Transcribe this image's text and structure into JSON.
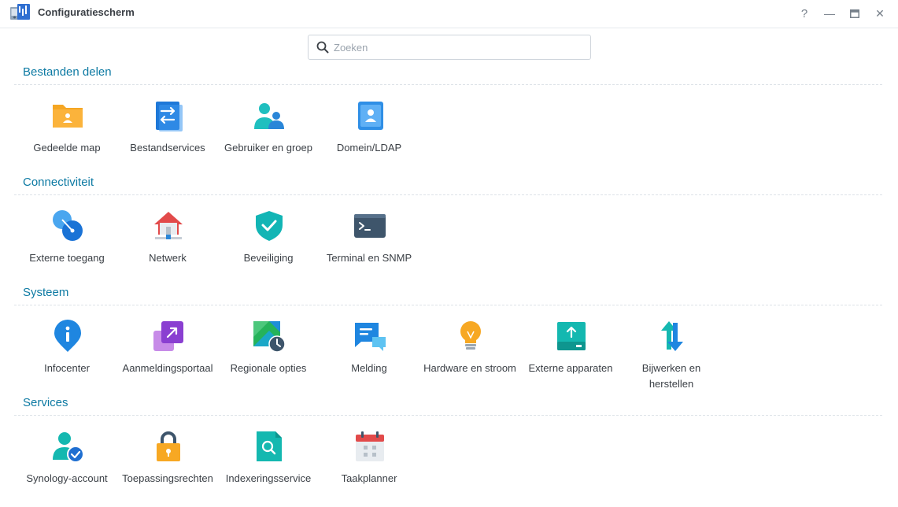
{
  "window": {
    "title": "Configuratiescherm",
    "help_glyph": "?",
    "minimize_glyph": "—",
    "close_glyph": "✕"
  },
  "search": {
    "placeholder": "Zoeken",
    "value": ""
  },
  "sections": [
    {
      "title": "Bestanden delen",
      "items": [
        {
          "label": "Gedeelde map",
          "icon": "shared-folder-icon"
        },
        {
          "label": "Bestandservices",
          "icon": "file-services-icon"
        },
        {
          "label": "Gebruiker en groep",
          "icon": "user-group-icon"
        },
        {
          "label": "Domein/LDAP",
          "icon": "domain-ldap-icon"
        }
      ]
    },
    {
      "title": "Connectiviteit",
      "items": [
        {
          "label": "Externe toegang",
          "icon": "external-access-icon"
        },
        {
          "label": "Netwerk",
          "icon": "network-icon"
        },
        {
          "label": "Beveiliging",
          "icon": "security-shield-icon"
        },
        {
          "label": "Terminal en SNMP",
          "icon": "terminal-icon"
        }
      ]
    },
    {
      "title": "Systeem",
      "items": [
        {
          "label": "Infocenter",
          "icon": "info-center-icon"
        },
        {
          "label": "Aanmeldingsportaal",
          "icon": "login-portal-icon"
        },
        {
          "label": "Regionale opties",
          "icon": "regional-options-icon"
        },
        {
          "label": "Melding",
          "icon": "notification-icon"
        },
        {
          "label": "Hardware en stroom",
          "icon": "hardware-power-icon"
        },
        {
          "label": "Externe apparaten",
          "icon": "external-devices-icon"
        },
        {
          "label": "Bijwerken en herstellen",
          "icon": "update-restore-icon"
        }
      ]
    },
    {
      "title": "Services",
      "items": [
        {
          "label": "Synology-account",
          "icon": "synology-account-icon"
        },
        {
          "label": "Toepassingsrechten",
          "icon": "application-privileges-icon"
        },
        {
          "label": "Indexeringsservice",
          "icon": "indexing-service-icon"
        },
        {
          "label": "Taakplanner",
          "icon": "task-scheduler-icon"
        }
      ]
    }
  ],
  "colors": {
    "section_title": "#0d7aa3",
    "divider": "#dde2e7",
    "label_text": "#3a3f45"
  }
}
